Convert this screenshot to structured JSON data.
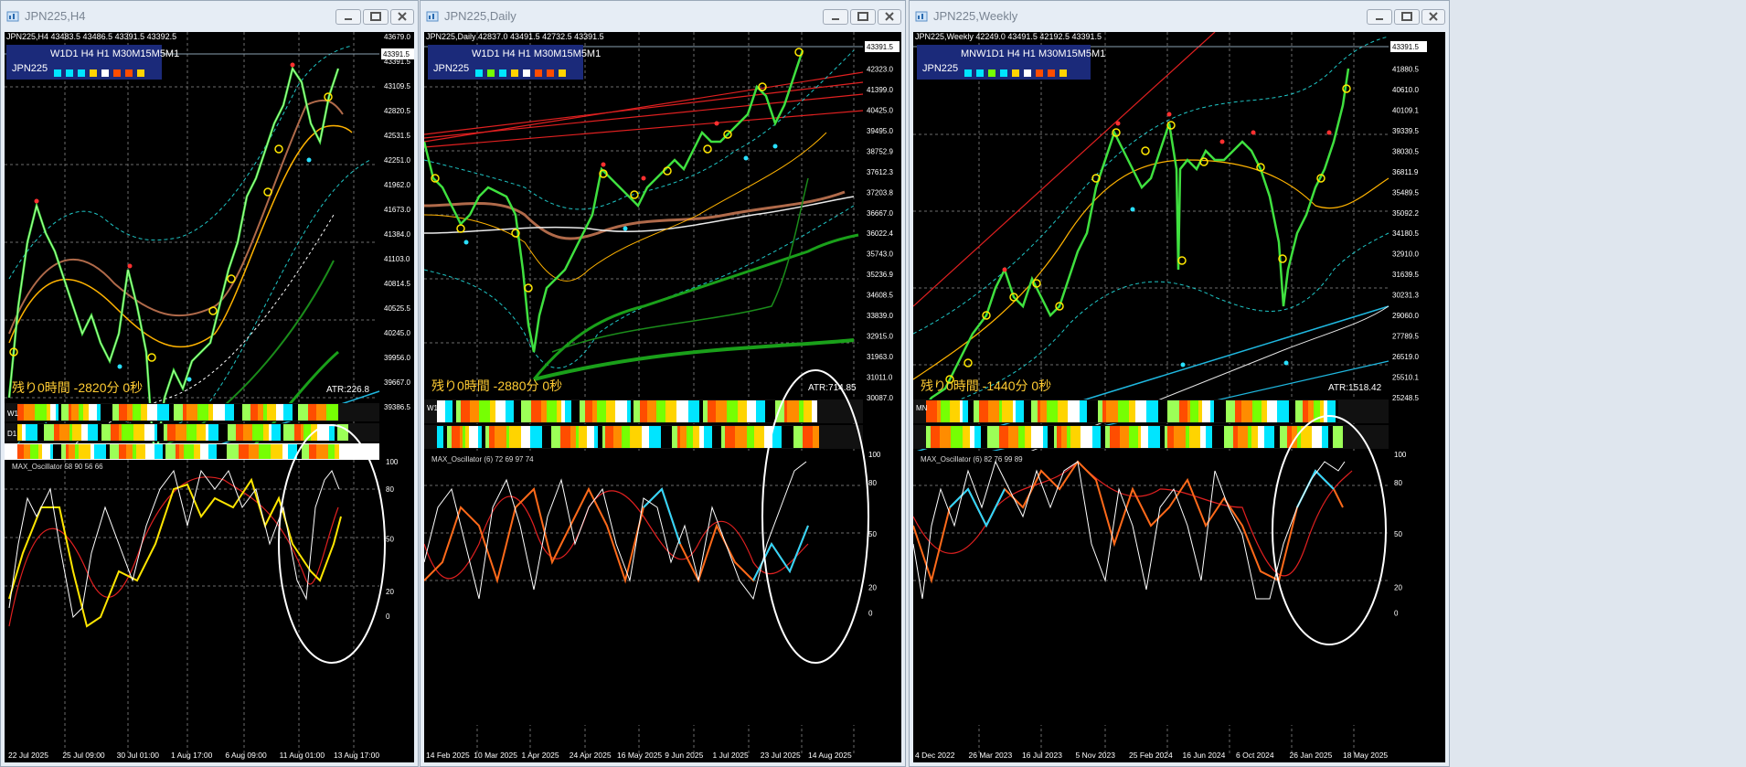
{
  "windows": [
    {
      "title": "JPN225,H4",
      "symbol_line": "JPN225,H4  43483.5 43486.5 43391.5 43392.5",
      "tf_label": "W1D1 H4 H1 M30M15M5M1",
      "symbol": "JPN225",
      "swatches": [
        "#00e5ff",
        "#00e5ff",
        "#00e5ff",
        "#ffd400",
        "#ffffff",
        "#ff4d00",
        "#ff4d00",
        "#ffd400"
      ],
      "countdown": "残り0時間 -2820分 0秒",
      "atr": "ATR:226.8",
      "rows": [
        "W1",
        "D1",
        ""
      ],
      "oscillator_label": "MAX_Oscillator 58 90 56 66",
      "price_axis": [
        "43679.0",
        "43391.5",
        "43109.5",
        "42820.5",
        "42531.5",
        "42251.0",
        "41962.0",
        "41673.0",
        "41384.0",
        "41103.0",
        "40814.5",
        "40525.5",
        "40245.0",
        "39956.0",
        "39667.0",
        "39386.5"
      ],
      "current_price": "43391.5",
      "osc_axis": [
        "100",
        "80",
        "50",
        "20",
        "0"
      ],
      "row_axis": [
        "1",
        "0",
        "1",
        "0",
        "1",
        "0"
      ],
      "time_axis": [
        "22 Jul 2025",
        "25 Jul 09:00",
        "30 Jul 01:00",
        "1 Aug 17:00",
        "6 Aug 09:00",
        "11 Aug 01:00",
        "13 Aug 17:00"
      ]
    },
    {
      "title": "JPN225,Daily",
      "symbol_line": "JPN225,Daily  42837.0 43491.5 42732.5 43391.5",
      "tf_label": "W1D1 H4 H1 M30M15M5M1",
      "symbol": "JPN225",
      "swatches": [
        "#00e5ff",
        "#76ff03",
        "#00e5ff",
        "#ffd400",
        "#ffffff",
        "#ff4d00",
        "#ff4d00",
        "#ffd400"
      ],
      "countdown": "残り0時間 -2880分 0秒",
      "atr": "ATR:714.85",
      "rows": [
        "W1",
        ""
      ],
      "oscillator_label": "MAX_Oscillator (6) 72 69 97 74",
      "price_axis": [
        "43391.5",
        "42323.0",
        "41399.0",
        "40425.0",
        "39495.0",
        "38752.9",
        "37612.3",
        "37203.8",
        "36667.0",
        "36022.4",
        "35743.0",
        "35236.9",
        "34608.5",
        "33839.0",
        "32915.0",
        "31963.0",
        "31011.0",
        "30087.0"
      ],
      "current_price": "43391.5",
      "osc_axis": [
        "100",
        "80",
        "50",
        "20",
        "0"
      ],
      "row_axis": [
        "1",
        "0",
        "1",
        "0"
      ],
      "time_axis": [
        "14 Feb 2025",
        "10 Mar 2025",
        "1 Apr 2025",
        "24 Apr 2025",
        "16 May 2025",
        "9 Jun 2025",
        "1 Jul 2025",
        "23 Jul 2025",
        "14 Aug 2025"
      ]
    },
    {
      "title": "JPN225,Weekly",
      "symbol_line": "JPN225,Weekly  42249.0 43491.5 42192.5 43391.5",
      "tf_label": "MNW1D1 H4 H1 M30M15M5M1",
      "symbol": "JPN225",
      "swatches": [
        "#00e5ff",
        "#00e5ff",
        "#76ff03",
        "#00e5ff",
        "#ffd400",
        "#ffffff",
        "#ff4d00",
        "#ff4d00",
        "#ffd400"
      ],
      "countdown": "残り0時間 -1440分 0秒",
      "atr": "ATR:1518.42",
      "rows": [
        "MN",
        ""
      ],
      "oscillator_label": "MAX_Oscillator (6) 82 76 99 89",
      "price_axis": [
        "43391.5",
        "41880.5",
        "40610.0",
        "40109.1",
        "39339.5",
        "38030.5",
        "36811.9",
        "35489.5",
        "35092.2",
        "34180.5",
        "32910.0",
        "31639.5",
        "30231.3",
        "29060.0",
        "27789.5",
        "26519.0",
        "25510.1",
        "25248.5"
      ],
      "current_price": "43391.5",
      "osc_axis": [
        "100",
        "80",
        "50",
        "20",
        "0"
      ],
      "row_axis": [
        "1",
        "0",
        "1",
        "0"
      ],
      "time_axis": [
        "4 Dec 2022",
        "26 Mar 2023",
        "16 Jul 2023",
        "5 Nov 2023",
        "25 Feb 2024",
        "16 Jun 2024",
        "6 Oct 2024",
        "26 Jan 2025",
        "18 May 2025"
      ]
    }
  ]
}
